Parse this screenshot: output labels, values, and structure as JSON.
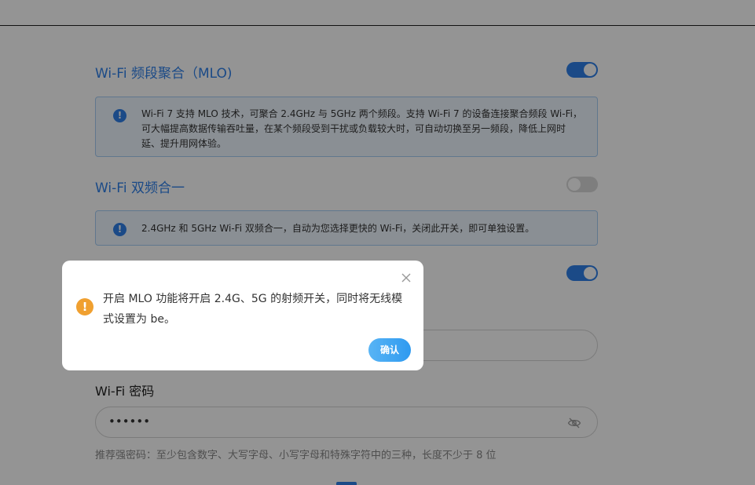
{
  "mlo": {
    "title": "Wi-Fi 频段聚合（MLO)",
    "enabled": true,
    "info": "Wi-Fi 7 支持 MLO 技术，可聚合 2.4GHz 与 5GHz 两个频段。支持 Wi-Fi 7 的设备连接聚合频段 Wi-Fi，可大幅提高数据传输吞吐量，在某个频段受到干扰或负载较大时，可自动切换至另一频段，降低上网时延、提升用网体验。"
  },
  "dual_band": {
    "title": "Wi-Fi 双频合一",
    "enabled": false,
    "info": "2.4GHz 和 5GHz Wi-Fi 双频合一，自动为您选择更快的 Wi-Fi，关闭此开关，即可单独设置。"
  },
  "third_toggle": {
    "enabled": true
  },
  "password": {
    "label": "Wi-Fi 密码",
    "value": "••••••",
    "hint": "推荐强密码：至少包含数字、大写字母、小写字母和特殊字符中的三种，长度不少于 8 位"
  },
  "dialog": {
    "message": "开启 MLO 功能将开启 2.4G、5G 的射频开关，同时将无线模式设置为 be。",
    "confirm_label": "确认"
  },
  "icons": {
    "info": "info-icon",
    "warning": "warning-icon",
    "close": "close-icon",
    "eye": "eye-off-icon"
  },
  "colors": {
    "accent": "#2f80e8",
    "warning": "#f0a030"
  }
}
